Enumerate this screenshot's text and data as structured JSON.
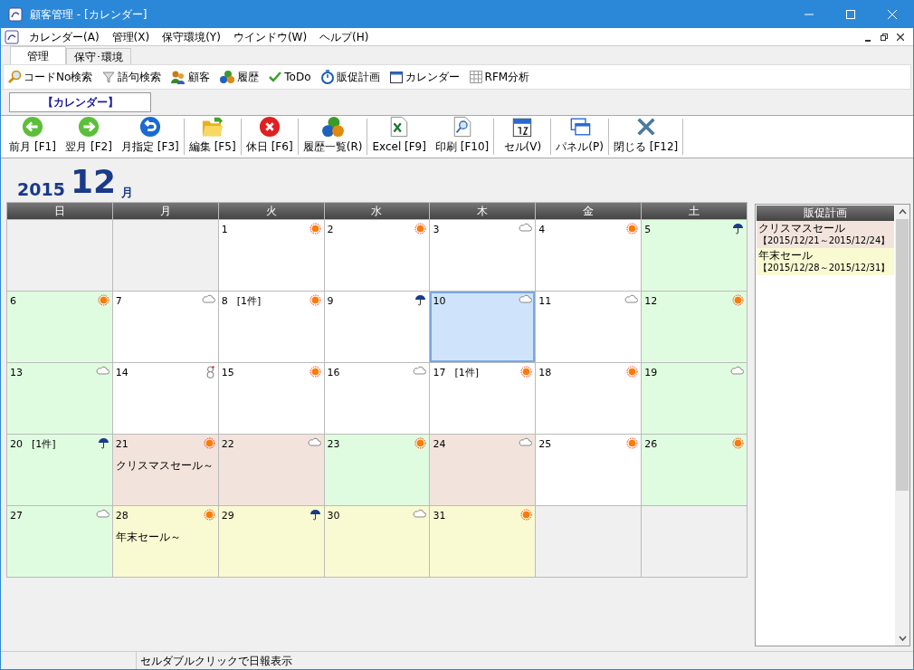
{
  "window": {
    "title": "顧客管理 - [カレンダー]"
  },
  "menu": [
    "カレンダー(A)",
    "管理(X)",
    "保守環境(Y)",
    "ウインドウ(W)",
    "ヘルプ(H)"
  ],
  "tabs": [
    {
      "label": "管理",
      "selected": true
    },
    {
      "label": "保守･環境",
      "selected": false
    }
  ],
  "quick_toolbar": [
    {
      "label": "コードNo検索",
      "kind": "search"
    },
    {
      "label": "語句検索",
      "kind": "funnel"
    },
    {
      "label": "顧客",
      "kind": "people"
    },
    {
      "label": "履歴",
      "kind": "coins"
    },
    {
      "label": "ToDo",
      "kind": "check"
    },
    {
      "label": "販促計画",
      "kind": "stopwatch"
    },
    {
      "label": "カレンダー",
      "kind": "calendar"
    },
    {
      "label": "RFM分析",
      "kind": "grid"
    }
  ],
  "breadcrumb": "【カレンダー】",
  "toolbar": [
    {
      "label": "前月 [F1]",
      "kind": "prev"
    },
    {
      "label": "翌月 [F2]",
      "kind": "next"
    },
    {
      "label": "月指定 [F3]",
      "kind": "undo"
    },
    {
      "label": "編集 [F5]",
      "kind": "folder"
    },
    {
      "label": "休日 [F6]",
      "kind": "stop"
    },
    {
      "label": "履歴一覧(R)",
      "kind": "coins"
    },
    {
      "label": "Excel [F9]",
      "kind": "excel"
    },
    {
      "label": "印刷 [F10]",
      "kind": "print"
    },
    {
      "label": "セル(V)",
      "kind": "calendar"
    },
    {
      "label": "パネル(P)",
      "kind": "windows"
    },
    {
      "label": "閉じる [F12]",
      "kind": "close"
    }
  ],
  "month": {
    "year": "2015",
    "month": "12",
    "unit": "月"
  },
  "weekdays": [
    "日",
    "月",
    "火",
    "水",
    "木",
    "金",
    "土"
  ],
  "cells": [
    {
      "color": "#f0f0f0",
      "selected": false
    },
    {
      "color": "#f0f0f0",
      "selected": false
    },
    {
      "day": "1",
      "kind": "sun",
      "color": "#ffffff",
      "selected": false
    },
    {
      "day": "2",
      "kind": "sun",
      "color": "#ffffff",
      "selected": false
    },
    {
      "day": "3",
      "kind": "cloud",
      "color": "#ffffff",
      "selected": false
    },
    {
      "day": "4",
      "kind": "sun",
      "color": "#ffffff",
      "selected": false
    },
    {
      "day": "5",
      "kind": "rain",
      "color": "#e0fce0",
      "selected": false
    },
    {
      "day": "6",
      "kind": "sun",
      "color": "#e0fce0",
      "selected": false
    },
    {
      "day": "7",
      "kind": "cloud",
      "color": "#ffffff",
      "selected": false
    },
    {
      "day": "8",
      "count": "[1件]",
      "kind": "sun",
      "color": "#ffffff",
      "selected": false
    },
    {
      "day": "9",
      "kind": "rain",
      "color": "#ffffff",
      "selected": false
    },
    {
      "day": "10",
      "kind": "cloud",
      "color": "#cfe4fb",
      "selected": true
    },
    {
      "day": "11",
      "kind": "cloud",
      "color": "#ffffff",
      "selected": false
    },
    {
      "day": "12",
      "kind": "sun",
      "color": "#e0fce0",
      "selected": false
    },
    {
      "day": "13",
      "kind": "cloud",
      "color": "#e0fce0",
      "selected": false
    },
    {
      "day": "14",
      "kind": "snow",
      "color": "#ffffff",
      "selected": false
    },
    {
      "day": "15",
      "kind": "sun",
      "color": "#ffffff",
      "selected": false
    },
    {
      "day": "16",
      "kind": "cloud",
      "color": "#ffffff",
      "selected": false
    },
    {
      "day": "17",
      "count": "[1件]",
      "kind": "sun",
      "color": "#ffffff",
      "selected": false
    },
    {
      "day": "18",
      "kind": "sun",
      "color": "#ffffff",
      "selected": false
    },
    {
      "day": "19",
      "kind": "cloud",
      "color": "#e0fce0",
      "selected": false
    },
    {
      "day": "20",
      "count": "[1件]",
      "kind": "rain",
      "color": "#e0fce0",
      "selected": false
    },
    {
      "day": "21",
      "kind": "sun",
      "event": "クリスマスセール～",
      "color": "#f2e4dc",
      "selected": false
    },
    {
      "day": "22",
      "kind": "cloud",
      "color": "#f2e4dc",
      "selected": false
    },
    {
      "day": "23",
      "kind": "sun",
      "color": "#e0fce0",
      "selected": false
    },
    {
      "day": "24",
      "kind": "cloud",
      "color": "#f2e4dc",
      "selected": false
    },
    {
      "day": "25",
      "kind": "sun",
      "color": "#ffffff",
      "selected": false
    },
    {
      "day": "26",
      "kind": "sun",
      "color": "#e0fce0",
      "selected": false
    },
    {
      "day": "27",
      "kind": "cloud",
      "color": "#e0fce0",
      "selected": false
    },
    {
      "day": "28",
      "kind": "sun",
      "event": "年末セール～",
      "color": "#fafad2",
      "selected": false
    },
    {
      "day": "29",
      "kind": "rain",
      "color": "#fafad2",
      "selected": false
    },
    {
      "day": "30",
      "kind": "cloud",
      "color": "#fafad2",
      "selected": false
    },
    {
      "day": "31",
      "kind": "sun",
      "color": "#fafad2",
      "selected": false
    },
    {
      "color": "#f0f0f0",
      "selected": false
    },
    {
      "color": "#f0f0f0",
      "selected": false
    }
  ],
  "promotions": {
    "title": "販促計画",
    "items": [
      {
        "name": "クリスマスセール",
        "period": "【2015/12/21～2015/12/24】",
        "color": "#f2e4dc"
      },
      {
        "name": "年末セール",
        "period": "【2015/12/28～2015/12/31】",
        "color": "#fafad2"
      }
    ]
  },
  "status_bar": "セルダブルクリックで日報表示"
}
